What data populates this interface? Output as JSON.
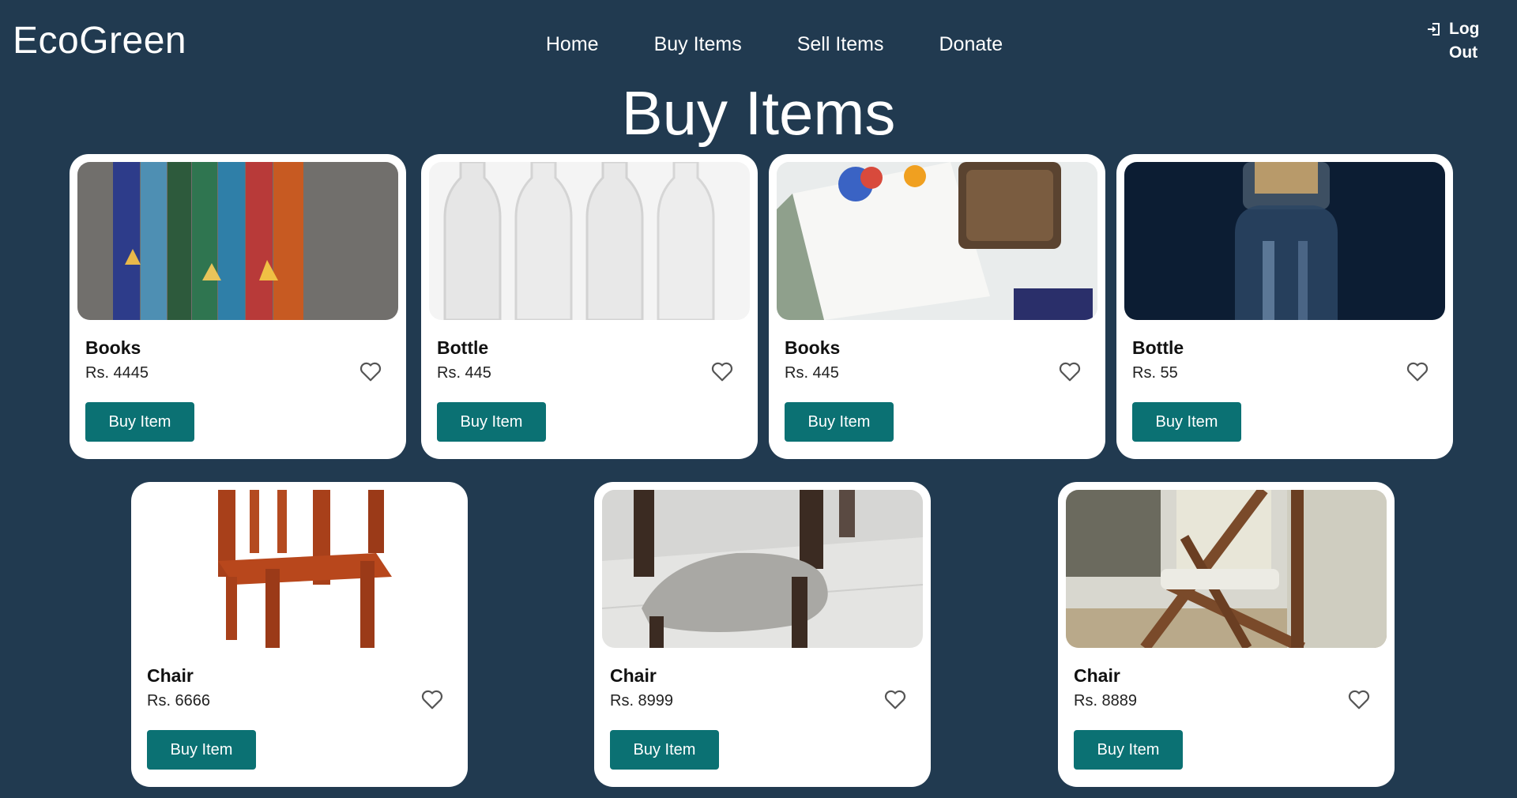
{
  "header": {
    "brand": "EcoGreen",
    "nav": [
      "Home",
      "Buy Items",
      "Sell Items",
      "Donate"
    ],
    "logout_label": "Log Out",
    "logout_icon": "logout-icon"
  },
  "page": {
    "title": "Buy Items"
  },
  "items": [
    {
      "name": "Books",
      "price": "Rs. 4445",
      "button": "Buy Item",
      "image": "book-spines-photo"
    },
    {
      "name": "Bottle",
      "price": "Rs. 445",
      "button": "Buy Item",
      "image": "glass-bottles-photo"
    },
    {
      "name": "Books",
      "price": "Rs. 445",
      "button": "Buy Item",
      "image": "paperback-book-photo"
    },
    {
      "name": "Bottle",
      "price": "Rs. 55",
      "button": "Buy Item",
      "image": "dark-bottle-photo"
    },
    {
      "name": "Chair",
      "price": "Rs. 6666",
      "button": "Buy Item",
      "image": "wooden-armchair-photo"
    },
    {
      "name": "Chair",
      "price": "Rs. 8999",
      "button": "Buy Item",
      "image": "upholstered-chair-photo"
    },
    {
      "name": "Chair",
      "price": "Rs. 8889",
      "button": "Buy Item",
      "image": "folding-chair-photo"
    }
  ],
  "colors": {
    "background": "#213a50",
    "card": "#ffffff",
    "button": "#0b7173",
    "text_light": "#ffffff"
  }
}
